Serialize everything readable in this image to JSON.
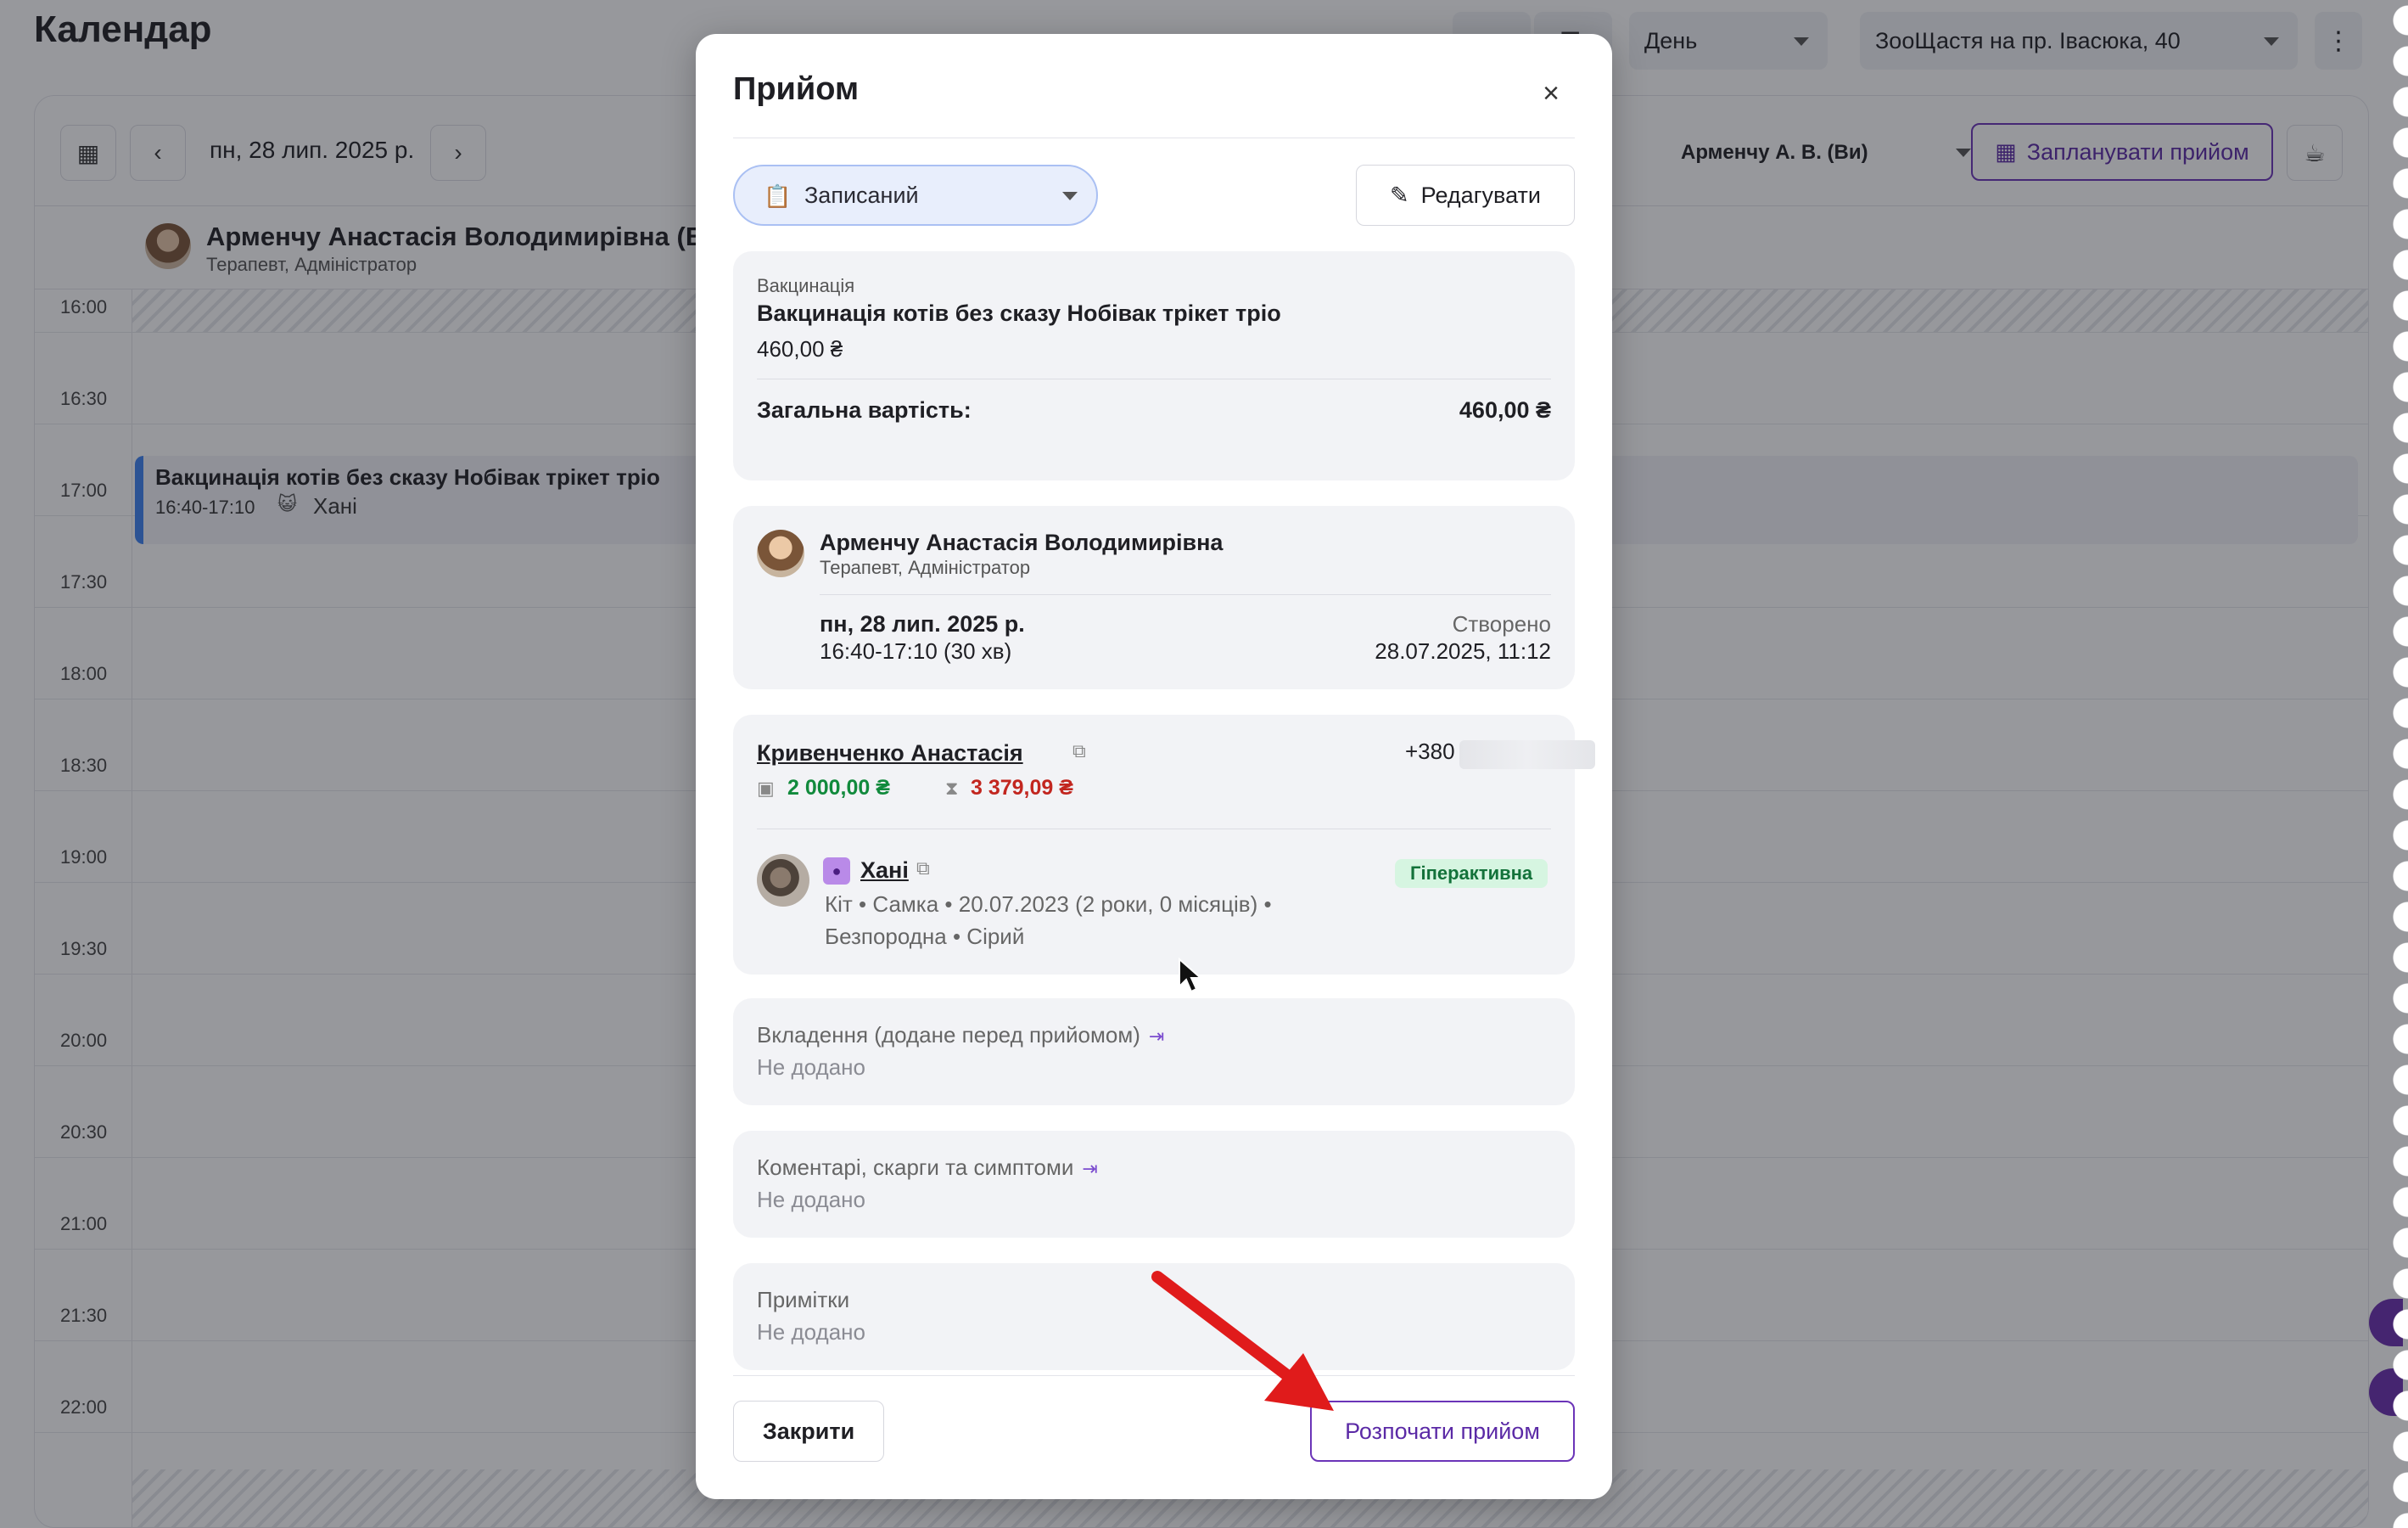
{
  "app": {
    "title": "Календар",
    "view_select": "День",
    "location_select": "ЗооЩастя на пр. Івасюка, 40"
  },
  "calendar": {
    "date": "пн, 28 лип. 2025 р.",
    "doctor_select": "Арменчу А. В. (Ви)",
    "schedule_button": "Запланувати прийом",
    "column_doctor_name": "Арменчу Анастасія Володимирівна (В",
    "column_doctor_role": "Терапевт, Адміністратор",
    "times": [
      "16:00",
      "16:30",
      "17:00",
      "17:30",
      "18:00",
      "18:30",
      "19:00",
      "19:30",
      "20:00",
      "20:30",
      "21:00",
      "21:30",
      "22:00"
    ],
    "event": {
      "title": "Вакцинація котів без сказу Нобівак трікет тріо",
      "time": "16:40-17:10",
      "pet": "Хані"
    }
  },
  "modal": {
    "title": "Прийом",
    "status": "Записаний",
    "edit_button": "Редагувати",
    "service": {
      "category": "Вакцинація",
      "name": "Вакцинація котів без сказу Нобівак трікет тріо",
      "price": "460,00 ₴",
      "total_label": "Загальна вартість:",
      "total_value": "460,00 ₴"
    },
    "doctor": {
      "name": "Арменчу Анастасія Володимирівна",
      "role": "Терапевт, Адміністратор",
      "date": "пн, 28 лип. 2025 р.",
      "time": "16:40-17:10 (30 хв)",
      "created_label": "Створено",
      "created_value": "28.07.2025, 11:12"
    },
    "client": {
      "name": "Кривенченко Анастасія",
      "phone": "+380",
      "balance": "2 000,00 ₴",
      "debt": "3 379,09 ₴"
    },
    "pet": {
      "name": "Хані",
      "badge": "Гіперактивна",
      "details_line1": "Кіт • Самка • 20.07.2023 (2 роки, 0 місяців) •",
      "details_line2": "Безпородна • Сірий"
    },
    "attachments": {
      "label": "Вкладення (додане перед прийомом)",
      "value": "Не додано"
    },
    "comments": {
      "label": "Коментарі, скарги та симптоми",
      "value": "Не додано"
    },
    "notes": {
      "label": "Примітки",
      "value": "Не додано"
    },
    "close_button": "Закрити",
    "start_button": "Розпочати прийом"
  },
  "colors": {
    "accent": "#6b34b8",
    "status_bg": "#e8eefc",
    "event_bar": "#3c82f0",
    "arrow": "#e01b1b",
    "badge_bg": "#d6f5e1"
  },
  "icons": [
    "calendar-icon",
    "chevron-left-icon",
    "chevron-right-icon",
    "clipboard-icon",
    "pencil-icon",
    "close-icon",
    "external-link-icon",
    "wallet-icon",
    "hourglass-icon",
    "cat-icon",
    "attach-icon",
    "coffee-icon",
    "kebab-menu-icon"
  ]
}
